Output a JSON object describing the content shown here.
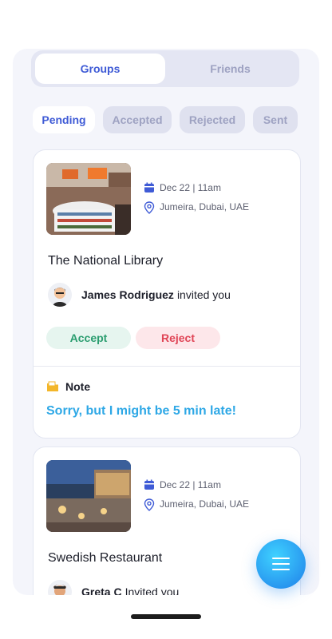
{
  "tabs": {
    "groups": "Groups",
    "friends": "Friends"
  },
  "filters": [
    "Pending",
    "Accepted",
    "Rejected",
    "Sent"
  ],
  "invites": [
    {
      "date": "Dec 22 | 11am",
      "location": "Jumeira, Dubai, UAE",
      "title": "The National Library",
      "inviter": "James Rodriguez",
      "invited_text": "invited you",
      "accept": "Accept",
      "reject": "Reject",
      "note_label": "Note",
      "note_text": "Sorry, but I might be 5 min late!"
    },
    {
      "date": "Dec 22 | 11am",
      "location": "Jumeira, Dubai, UAE",
      "title": "Swedish Restaurant",
      "inviter": "Greta C",
      "invited_text": "Invited you"
    }
  ],
  "colors": {
    "accent": "#3f5bd6",
    "accept": "#2a9d6f",
    "reject": "#e04556",
    "note": "#2ea8e6",
    "fab": "#1f7fe9"
  },
  "icons": {
    "calendar": "calendar-icon",
    "location": "map-pin-icon",
    "note": "folder-note-icon",
    "fab": "menu-icon"
  }
}
